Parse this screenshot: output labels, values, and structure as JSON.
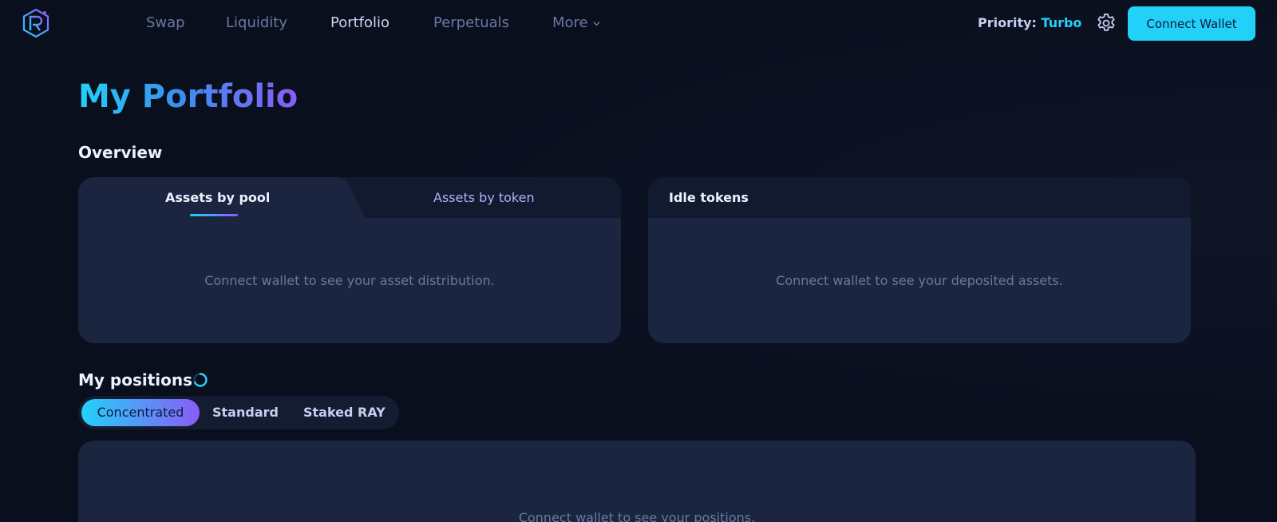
{
  "nav": {
    "items": [
      {
        "label": "Swap"
      },
      {
        "label": "Liquidity"
      },
      {
        "label": "Portfolio"
      },
      {
        "label": "Perpetuals"
      },
      {
        "label": "More"
      }
    ],
    "active": "Portfolio"
  },
  "header": {
    "priority_label": "Priority:",
    "priority_value": "Turbo",
    "connect_label": "Connect Wallet"
  },
  "page": {
    "title": "My Portfolio"
  },
  "overview": {
    "title": "Overview",
    "tabs": [
      {
        "label": "Assets by pool",
        "active": true
      },
      {
        "label": "Assets by token",
        "active": false
      }
    ],
    "asset_empty": "Connect wallet to see your asset distribution.",
    "idle_title": "Idle tokens",
    "idle_empty": "Connect wallet to see your deposited assets."
  },
  "positions": {
    "title": "My positions",
    "tabs": [
      {
        "label": "Concentrated",
        "active": true
      },
      {
        "label": "Standard",
        "active": false
      },
      {
        "label": "Staked RAY",
        "active": false
      }
    ],
    "empty": "Connect wallet to see your positions."
  },
  "colors": {
    "accent": "#22d1f8",
    "accent_purple": "#8a5cf6",
    "background": "#0a0f1e",
    "card": "#1b2540"
  },
  "icons": {
    "logo": "raydium-logo-icon",
    "more": "chevron-down-icon",
    "settings": "gear-icon",
    "loading": "spinner-icon"
  }
}
